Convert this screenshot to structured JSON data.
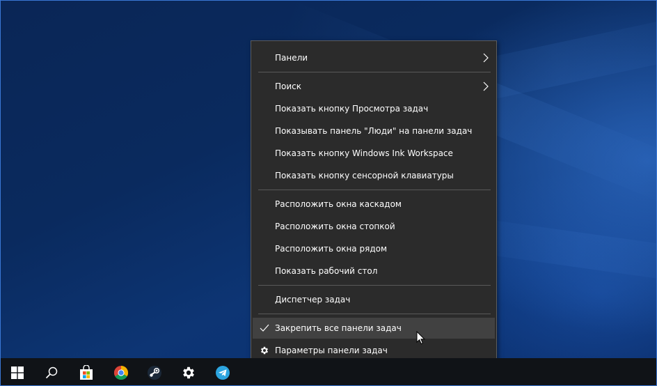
{
  "context_menu": {
    "items": [
      {
        "label": "Панели"
      },
      {
        "label": "Поиск"
      },
      {
        "label": "Показать кнопку Просмотра задач"
      },
      {
        "label": "Показывать панель \"Люди\" на панели задач"
      },
      {
        "label": "Показать кнопку Windows Ink Workspace"
      },
      {
        "label": "Показать кнопку сенсорной клавиатуры"
      },
      {
        "label": "Расположить окна каскадом"
      },
      {
        "label": "Расположить окна стопкой"
      },
      {
        "label": "Расположить окна рядом"
      },
      {
        "label": "Показать рабочий стол"
      },
      {
        "label": "Диспетчер задач"
      },
      {
        "label": "Закрепить все панели задач"
      },
      {
        "label": "Параметры панели задач"
      }
    ]
  },
  "taskbar": {
    "icons": [
      "windows-start-icon",
      "search-icon",
      "store-icon",
      "chrome-icon",
      "steam-icon",
      "settings-gear-icon",
      "telegram-icon"
    ]
  },
  "colors": {
    "menu_background": "#2b2b2b",
    "menu_hover": "#414141",
    "taskbar": "#101317",
    "accent": "#3a78d6"
  }
}
